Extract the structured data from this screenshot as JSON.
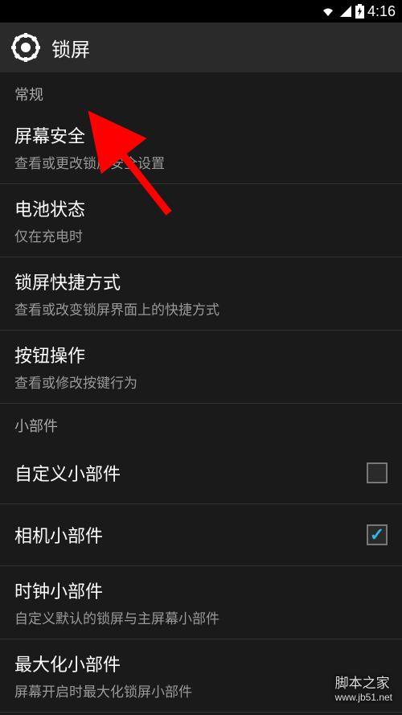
{
  "status_bar": {
    "time": "4:16"
  },
  "header": {
    "title": "锁屏"
  },
  "sections": {
    "general": {
      "header": "常规",
      "items": {
        "screen_security": {
          "title": "屏幕安全",
          "subtitle": "查看或更改锁屏安全设置"
        },
        "battery_status": {
          "title": "电池状态",
          "subtitle": "仅在充电时"
        },
        "lockscreen_shortcuts": {
          "title": "锁屏快捷方式",
          "subtitle": "查看或改变锁屏界面上的快捷方式"
        },
        "button_actions": {
          "title": "按钮操作",
          "subtitle": "查看或修改按键行为"
        }
      }
    },
    "widgets": {
      "header": "小部件",
      "items": {
        "custom_widget": {
          "title": "自定义小部件",
          "checked": false
        },
        "camera_widget": {
          "title": "相机小部件",
          "checked": true
        },
        "clock_widget": {
          "title": "时钟小部件",
          "subtitle": "自定义默认的锁屏与主屏幕小部件"
        },
        "maximize_widget": {
          "title": "最大化小部件",
          "subtitle": "屏幕开启时最大化锁屏小部件"
        }
      }
    }
  },
  "watermark": {
    "brand": "脚本之家",
    "url": "www.jb51.net"
  }
}
